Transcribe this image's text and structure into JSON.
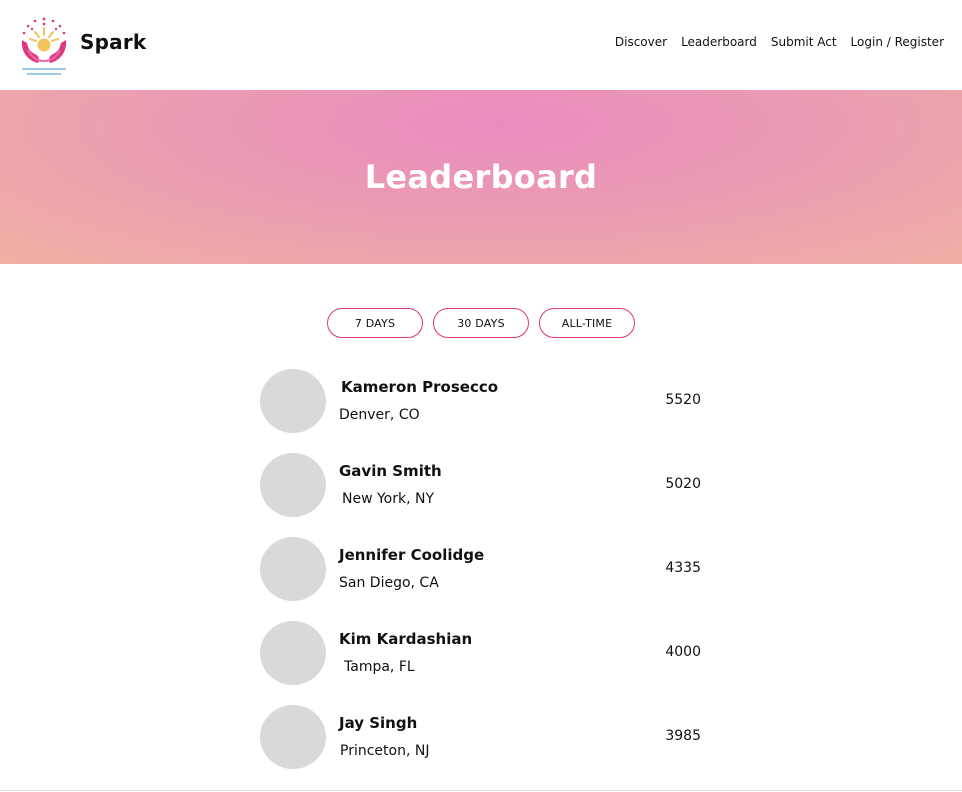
{
  "brand": {
    "name": "Spark",
    "logo_icon": "sun-hands-logo-icon"
  },
  "nav": {
    "items": [
      {
        "label": "Discover"
      },
      {
        "label": "Leaderboard"
      },
      {
        "label": "Submit Act"
      },
      {
        "label": "Login / Register"
      }
    ]
  },
  "hero": {
    "title": "Leaderboard"
  },
  "filters": {
    "tabs": [
      {
        "label": "7 DAYS"
      },
      {
        "label": "30 DAYS"
      },
      {
        "label": "ALL-TIME"
      }
    ],
    "accent_color": "#e0357f"
  },
  "leaderboard": {
    "entries": [
      {
        "name": "Kameron Prosecco",
        "location": "Denver, CO",
        "score": "5520"
      },
      {
        "name": "Gavin Smith",
        "location": "New York, NY",
        "score": "5020"
      },
      {
        "name": "Jennifer Coolidge",
        "location": "San Diego, CA",
        "score": "4335"
      },
      {
        "name": "Kim Kardashian",
        "location": "Tampa, FL",
        "score": "4000"
      },
      {
        "name": "Jay Singh",
        "location": "Princeton, NJ",
        "score": "3985"
      }
    ]
  },
  "colors": {
    "hero_gradient_center": "#ea8bbd",
    "hero_gradient_edge": "#efb0a2",
    "avatar_placeholder": "#d9d9d9"
  }
}
